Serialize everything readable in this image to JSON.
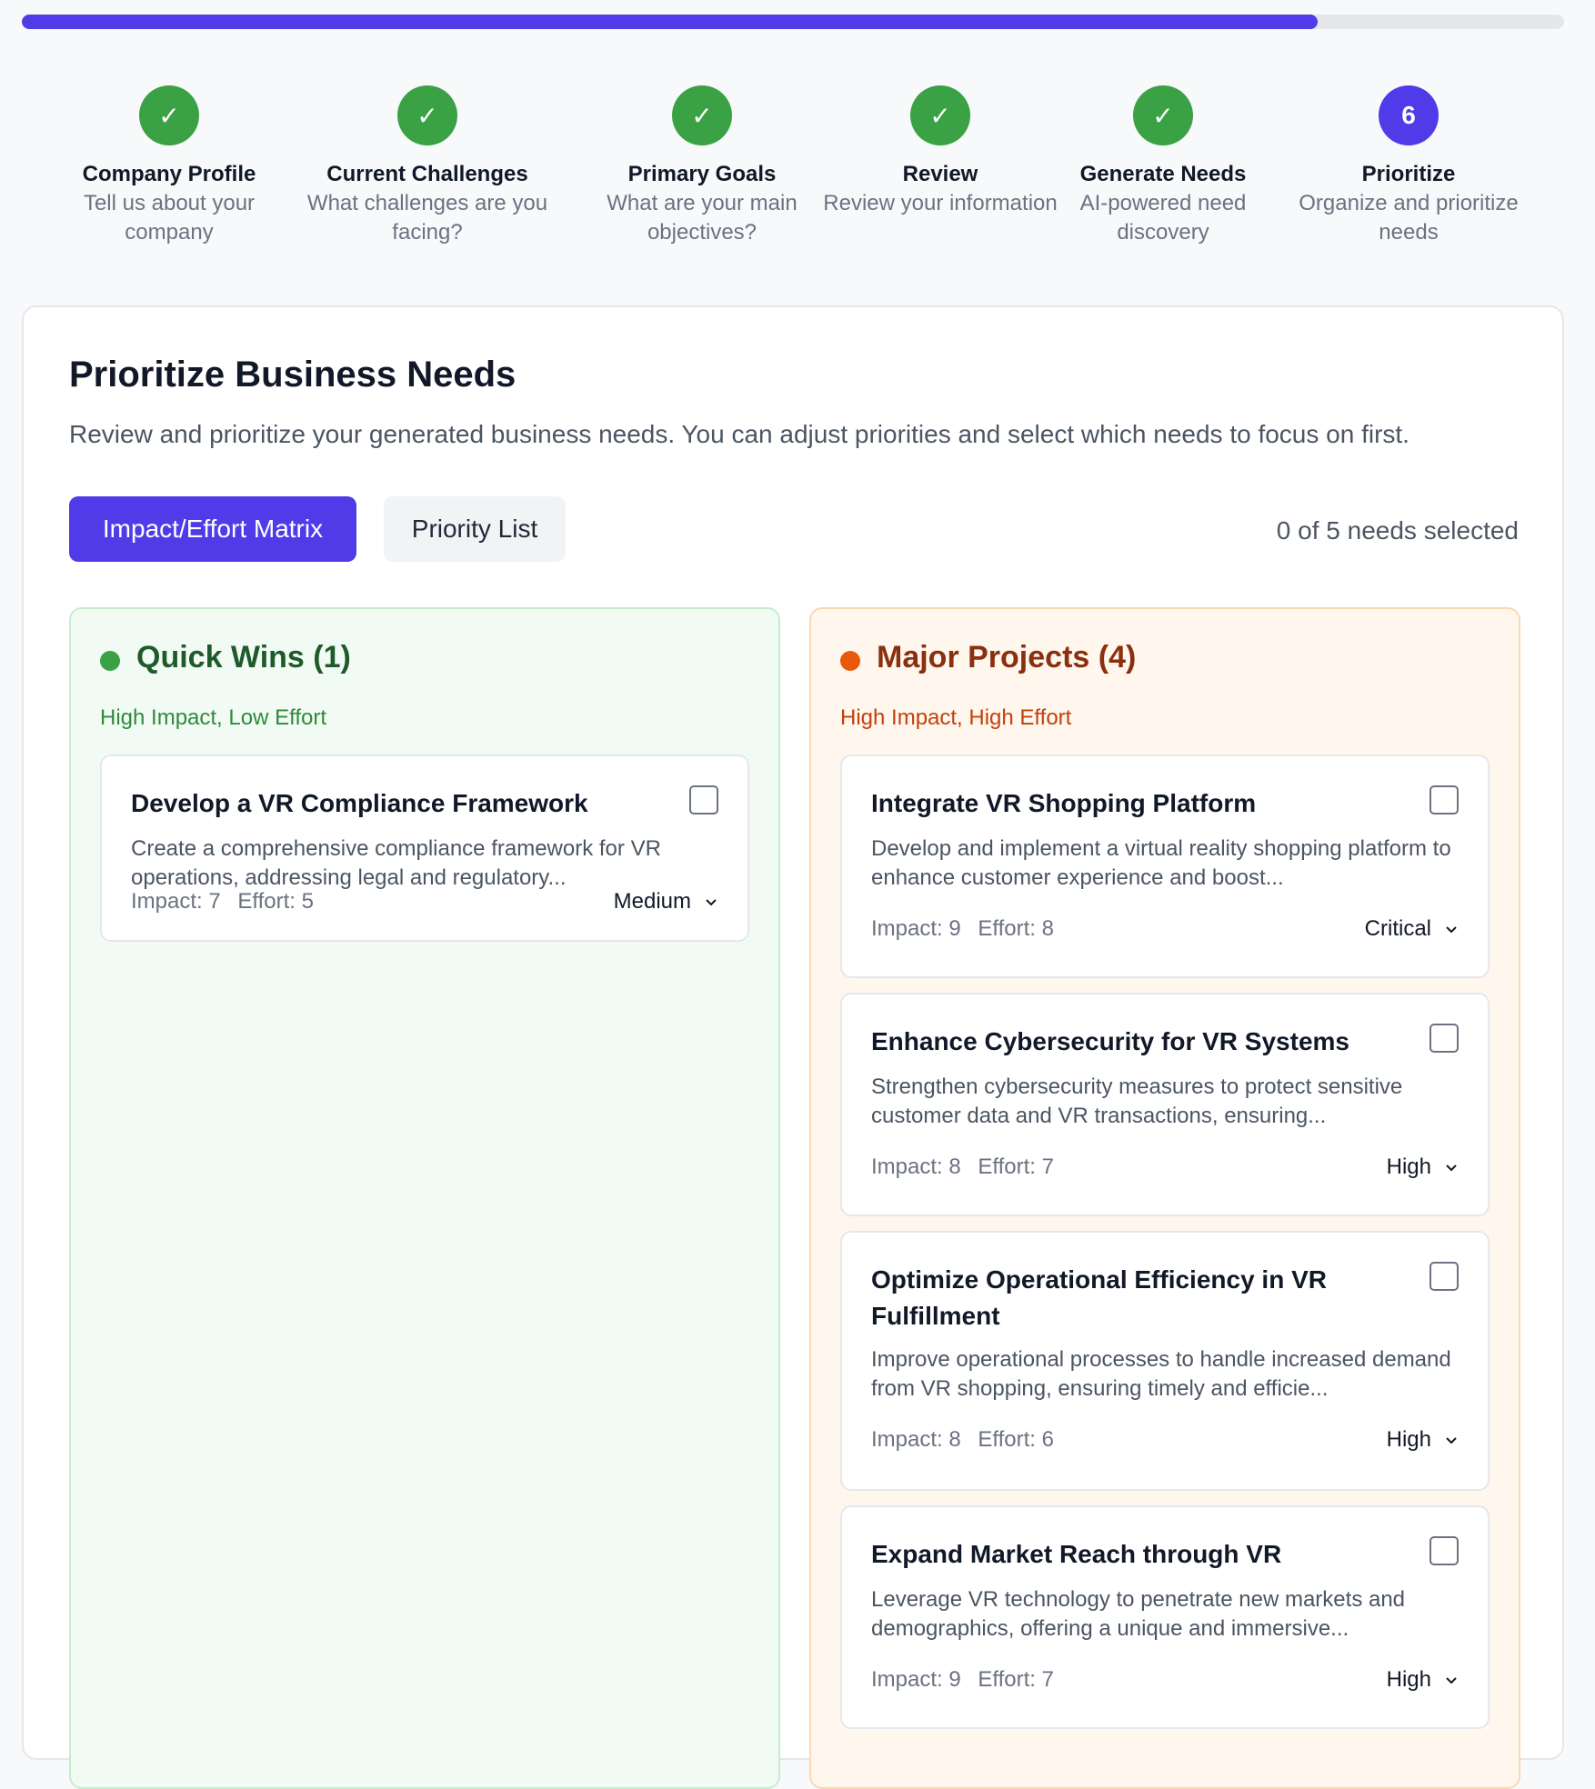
{
  "progress": {
    "fraction": 0.84
  },
  "steps": [
    {
      "title": "Company Profile",
      "desc": "Tell us about your company",
      "status": "done"
    },
    {
      "title": "Current Challenges",
      "desc": "What challenges are you facing?",
      "status": "done"
    },
    {
      "title": "Primary Goals",
      "desc": "What are your main objectives?",
      "status": "done"
    },
    {
      "title": "Review",
      "desc": "Review your information",
      "status": "done"
    },
    {
      "title": "Generate Needs",
      "desc": "AI-powered need discovery",
      "status": "done"
    },
    {
      "title": "Prioritize",
      "desc": "Organize and prioritize needs",
      "status": "current",
      "number": "6"
    }
  ],
  "page": {
    "title": "Prioritize Business Needs",
    "subtitle": "Review and prioritize your generated business needs. You can adjust priorities and select which needs to focus on first.",
    "tabs": {
      "matrix": "Impact/Effort Matrix",
      "list": "Priority List"
    },
    "selected_count": "0 of 5 needs selected"
  },
  "quick_wins": {
    "title": "Quick Wins (1)",
    "subtitle": "High Impact, Low Effort",
    "items": [
      {
        "title": "Develop a VR Compliance Framework",
        "desc": "Create a comprehensive compliance framework for VR operations, addressing legal and regulatory...",
        "impact": "Impact: 7",
        "effort": "Effort: 5",
        "priority": "Medium"
      }
    ]
  },
  "major_projects": {
    "title": "Major Projects (4)",
    "subtitle": "High Impact, High Effort",
    "items": [
      {
        "title": "Integrate VR Shopping Platform",
        "desc": "Develop and implement a virtual reality shopping platform to enhance customer experience and boost...",
        "impact": "Impact: 9",
        "effort": "Effort: 8",
        "priority": "Critical"
      },
      {
        "title": "Enhance Cybersecurity for VR Systems",
        "desc": "Strengthen cybersecurity measures to protect sensitive customer data and VR transactions, ensuring...",
        "impact": "Impact: 8",
        "effort": "Effort: 7",
        "priority": "High"
      },
      {
        "title": "Optimize Operational Efficiency in VR Fulfillment",
        "desc": "Improve operational processes to handle increased demand from VR shopping, ensuring timely and efficie...",
        "impact": "Impact: 8",
        "effort": "Effort: 6",
        "priority": "High"
      },
      {
        "title": "Expand Market Reach through VR",
        "desc": "Leverage VR technology to penetrate new markets and demographics, offering a unique and immersive...",
        "impact": "Impact: 9",
        "effort": "Effort: 7",
        "priority": "High"
      }
    ]
  }
}
